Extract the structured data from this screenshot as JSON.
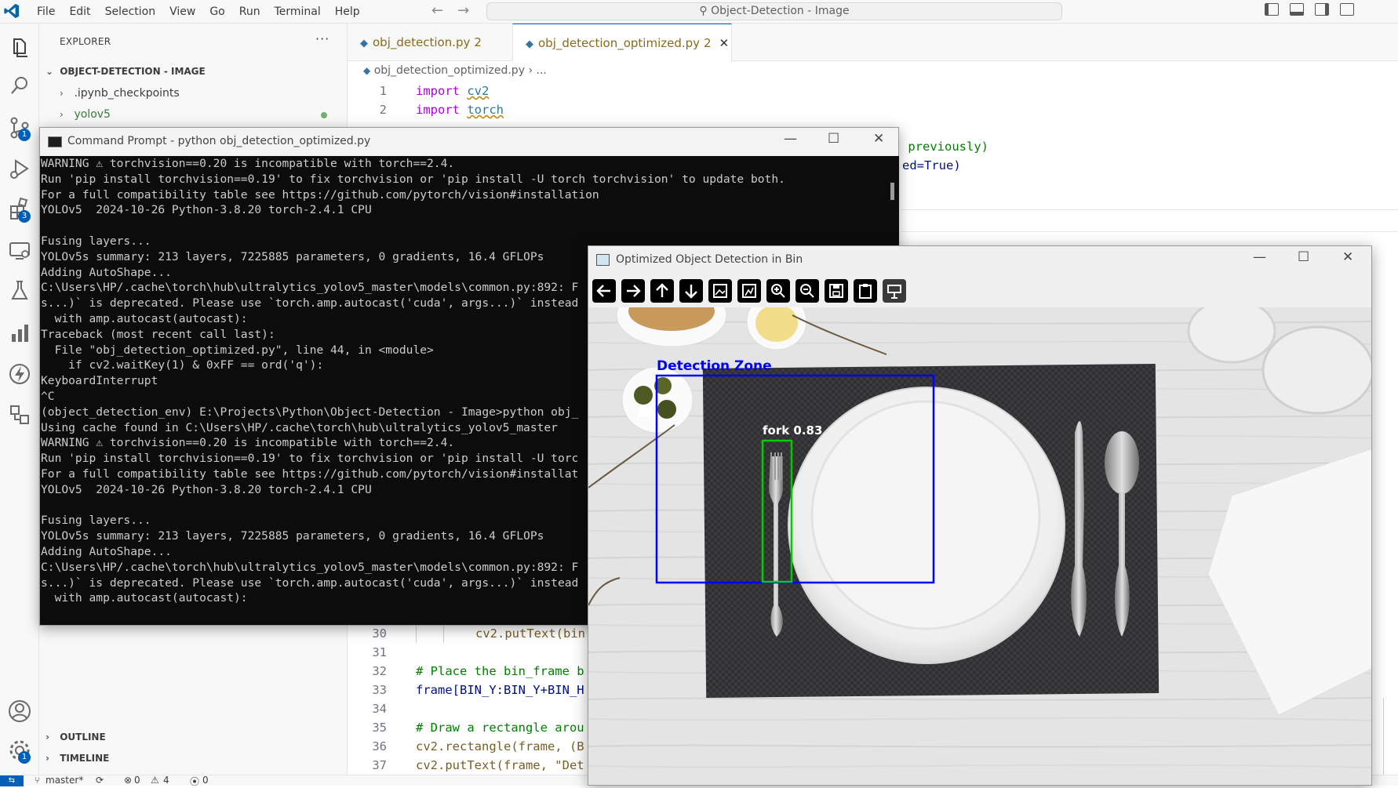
{
  "titlebar": {
    "menu": [
      "File",
      "Edit",
      "Selection",
      "View",
      "Go",
      "Run",
      "Terminal",
      "Help"
    ],
    "command_center": "Object-Detection - Image"
  },
  "activity": {
    "scm_badge": "1",
    "extensions_badge": "3",
    "settings_badge": "1"
  },
  "sidebar": {
    "title": "EXPLORER",
    "folder": "OBJECT-DETECTION - IMAGE",
    "items": [
      ".ipynb_checkpoints",
      "yolov5"
    ],
    "outline": "OUTLINE",
    "timeline": "TIMELINE"
  },
  "tabs": [
    {
      "name": "obj_detection.py",
      "count": "2"
    },
    {
      "name": "obj_detection_optimized.py",
      "count": "2"
    }
  ],
  "breadcrumb": {
    "file": "obj_detection_optimized.py",
    "rest": "..."
  },
  "code": {
    "l1": {
      "n": "1",
      "kw": "import",
      "mod": "cv2"
    },
    "l2": {
      "n": "2",
      "kw": "import",
      "mod": "torch"
    },
    "frag1": " previously)",
    "frag2": "ed=True)",
    "l30": {
      "n": "30",
      "text": "cv2.putText(bin"
    },
    "l31": {
      "n": "31"
    },
    "l32": {
      "n": "32",
      "text": "# Place the bin_frame b"
    },
    "l33": {
      "n": "33",
      "text": "frame[BIN_Y:BIN_Y+BIN_H"
    },
    "l34": {
      "n": "34"
    },
    "l35": {
      "n": "35",
      "text": "# Draw a rectangle arou"
    },
    "l36": {
      "n": "36",
      "text": "cv2.rectangle(frame, (B"
    },
    "l37": {
      "n": "37",
      "text": "cv2.putText(frame, \"Det"
    }
  },
  "statusbar": {
    "branch": "master*",
    "errors": "0",
    "warnings": "4",
    "ports": "0"
  },
  "cmd": {
    "title": "Command Prompt - python  obj_detection_optimized.py",
    "lines": [
      "WARNING ⚠ torchvision==0.20 is incompatible with torch==2.4.",
      "Run 'pip install torchvision==0.19' to fix torchvision or 'pip install -U torch torchvision' to update both.",
      "For a full compatibility table see https://github.com/pytorch/vision#installation",
      "YOLOv5  2024-10-26 Python-3.8.20 torch-2.4.1 CPU",
      "",
      "Fusing layers...",
      "YOLOv5s summary: 213 layers, 7225885 parameters, 0 gradients, 16.4 GFLOPs",
      "Adding AutoShape...",
      "C:\\Users\\HP/.cache\\torch\\hub\\ultralytics_yolov5_master\\models\\common.py:892: F",
      "s...)` is deprecated. Please use `torch.amp.autocast('cuda', args...)` instead",
      "  with amp.autocast(autocast):",
      "Traceback (most recent call last):",
      "  File \"obj_detection_optimized.py\", line 44, in <module>",
      "    if cv2.waitKey(1) & 0xFF == ord('q'):",
      "KeyboardInterrupt",
      "^C",
      "(object_detection_env) E:\\Projects\\Python\\Object-Detection - Image>python obj_",
      "Using cache found in C:\\Users\\HP/.cache\\torch\\hub\\ultralytics_yolov5_master",
      "WARNING ⚠ torchvision==0.20 is incompatible with torch==2.4.",
      "Run 'pip install torchvision==0.19' to fix torchvision or 'pip install -U torc",
      "For a full compatibility table see https://github.com/pytorch/vision#installat",
      "YOLOv5  2024-10-26 Python-3.8.20 torch-2.4.1 CPU",
      "",
      "Fusing layers...",
      "YOLOv5s summary: 213 layers, 7225885 parameters, 0 gradients, 16.4 GFLOPs",
      "Adding AutoShape...",
      "C:\\Users\\HP/.cache\\torch\\hub\\ultralytics_yolov5_master\\models\\common.py:892: F",
      "s...)` is deprecated. Please use `torch.amp.autocast('cuda', args...)` instead",
      "  with amp.autocast(autocast):"
    ]
  },
  "detection": {
    "title": "Optimized Object Detection in Bin",
    "toolbar": [
      "arrow-left-icon",
      "arrow-right-icon",
      "arrow-up-icon",
      "arrow-down-icon",
      "image-icon",
      "image-stats-icon",
      "zoom-in-icon",
      "zoom-out-icon",
      "save-icon",
      "clipboard-icon",
      "properties-icon"
    ],
    "zone_label": "Detection Zone",
    "object_label": "fork 0.83",
    "zone_color": "#0000ff",
    "object_color": "#00cc00"
  }
}
